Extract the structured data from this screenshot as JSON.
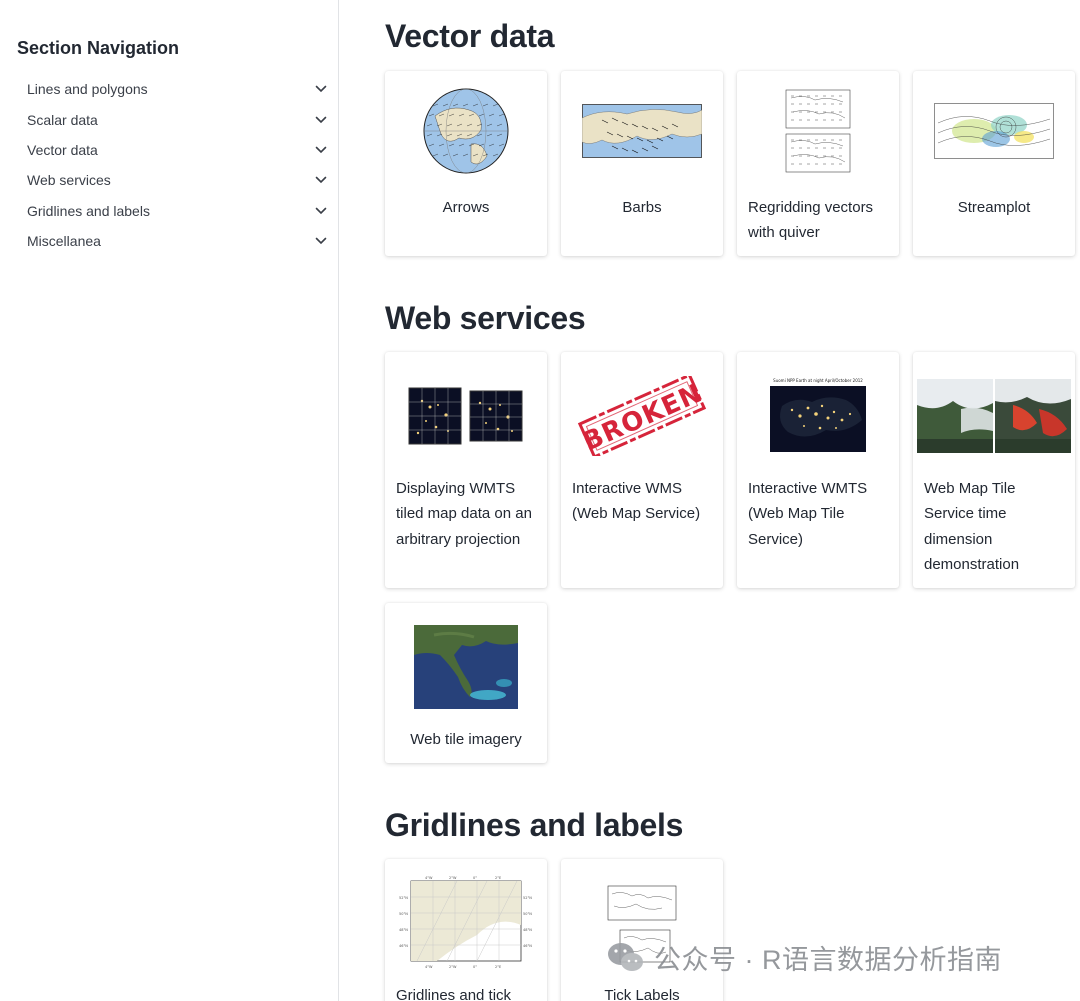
{
  "sidebar": {
    "title": "Section Navigation",
    "items": [
      {
        "label": "Lines and polygons"
      },
      {
        "label": "Scalar data"
      },
      {
        "label": "Vector data"
      },
      {
        "label": "Web services"
      },
      {
        "label": "Gridlines and labels"
      },
      {
        "label": "Miscellanea"
      }
    ]
  },
  "sections": {
    "vector": {
      "title": "Vector data",
      "cards": [
        {
          "label": "Arrows",
          "thumb": "globe-arrows-thumbnail"
        },
        {
          "label": "Barbs",
          "thumb": "barbs-map-thumbnail"
        },
        {
          "label": "Regridding vectors with quiver",
          "thumb": "regrid-quiver-thumbnail"
        },
        {
          "label": "Streamplot",
          "thumb": "streamplot-thumbnail"
        }
      ]
    },
    "web": {
      "title": "Web services",
      "cards": [
        {
          "label": "Displaying WMTS tiled map data on an arbitrary projection",
          "thumb": "wmts-night-lights-thumbnail"
        },
        {
          "label": "Interactive WMS (Web Map Service)",
          "thumb": "broken-stamp-thumbnail",
          "stamp_text": "BROKEN"
        },
        {
          "label": "Interactive WMTS (Web Map Tile Service)",
          "thumb": "europe-night-thumbnail",
          "thumb_caption": "Suomi NPP Earth at night April/October 2012"
        },
        {
          "label": "Web Map Tile Service time dimension demonstration",
          "thumb": "satellite-compare-thumbnail"
        },
        {
          "label": "Web tile imagery",
          "thumb": "florida-satellite-thumbnail"
        }
      ]
    },
    "grid": {
      "title": "Gridlines and labels",
      "cards": [
        {
          "label": "Gridlines and tick",
          "thumb": "gridlines-map-thumbnail"
        },
        {
          "label": "Tick Labels",
          "thumb": "tick-labels-thumbnail"
        }
      ]
    }
  },
  "watermark": {
    "text": "公众号 · R语言数据分析指南",
    "icon": "wechat-icon"
  },
  "colors": {
    "ocean": "#9fc4e8",
    "land": "#eae2c6",
    "night": "#0b0f24",
    "stamp_red": "#d6243a"
  }
}
